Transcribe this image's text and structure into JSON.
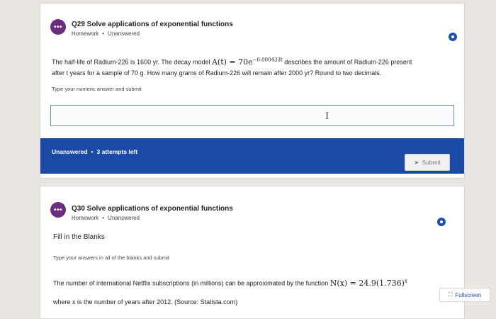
{
  "question1": {
    "badge": "•••",
    "title": "Q29 Solve applications of exponential functions",
    "category": "Homework",
    "state": "Unanswered",
    "body_line1_before": "The half-life of Radium-226 is 1600 yr. The decay model ",
    "math_model_lhs": "A(t) = 70e",
    "math_model_exp": "−0.000433t",
    "body_line1_after": " describes the amount of Radium-226 present",
    "body_line2": "after t years for a sample of 70 g. How many grams of Radium-226 will remain after 2000 yr? Round to two decimals.",
    "hint": "Type your numeric answer and submit",
    "answer_value": "",
    "status_label": "Unanswered",
    "attempts": "3 attempts left",
    "submit_label": "Submit"
  },
  "question2": {
    "badge": "•••",
    "title": "Q30 Solve applications of exponential functions",
    "category": "Homework",
    "state": "Unanswered",
    "instruction": "Fill in the Blanks",
    "hint": "Type your answers in all of the blanks and submit",
    "body_line1": "The number of international Netflix subscriptions (in millions) can be approximated by the function ",
    "math_fn": "N(x) = 24.9(1.736)",
    "math_fn_exp": "x",
    "body_line2": "where x is the number of years after 2012. (Source: Statista.com)"
  },
  "fullscreen_label": "Fullscreen",
  "colors": {
    "primary_blue": "#1b4aa6",
    "badge_purple": "#6b2d7d"
  }
}
